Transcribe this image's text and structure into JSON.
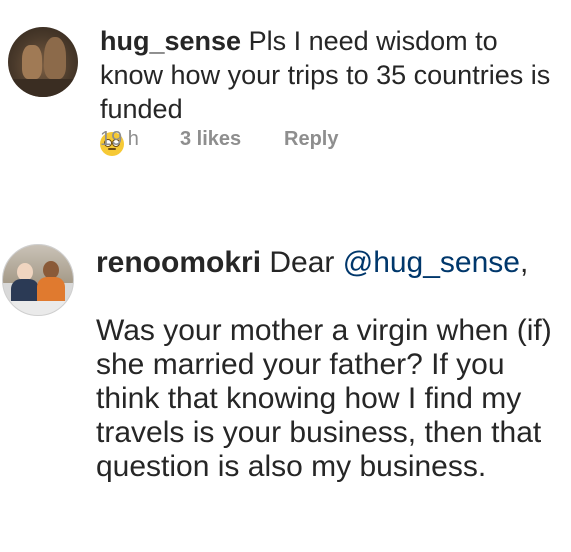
{
  "comments": [
    {
      "username": "hug_sense",
      "text": "Pls I need wisdom to know how your trips to 35 countries is funded",
      "emoji": "rolling-eyes-emoji",
      "time": "19 h",
      "likes": "3 likes",
      "reply_label": "Reply"
    },
    {
      "username": "renoomokri",
      "greeting_prefix": "Dear ",
      "mention": "@hug_sense",
      "greeting_suffix": ",",
      "body": "Was your mother a virgin when (if) she married your father? If you think that knowing how I find my travels is your business, then that question is also my business."
    }
  ]
}
